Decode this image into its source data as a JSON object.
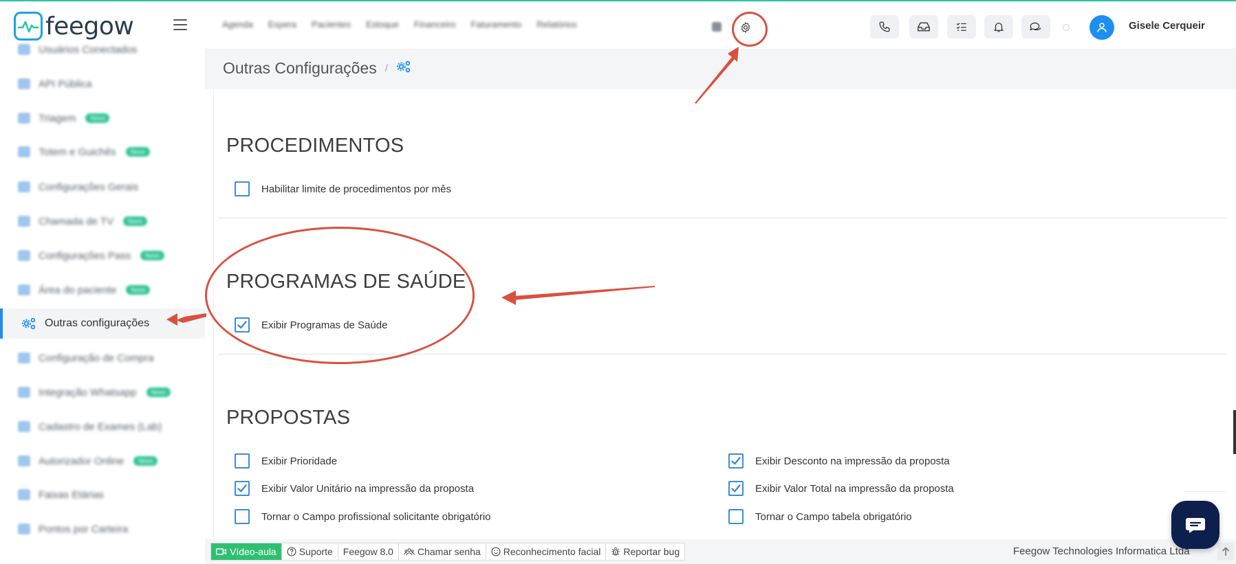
{
  "brand": {
    "logo_text": "feegow"
  },
  "header": {
    "nav_items": [
      "Agenda",
      "Espera",
      "Pacientes",
      "Estoque",
      "Financeiro",
      "Faturamento",
      "Relatórios"
    ],
    "username": "Gisele Cerqueir",
    "toolbar_icons": [
      "phone-icon",
      "inbox-icon",
      "task-list-icon",
      "bell-icon",
      "chat-icon"
    ]
  },
  "sidebar": {
    "items": [
      {
        "label": "Usuários Conectados",
        "badge": ""
      },
      {
        "label": "API Pública",
        "badge": ""
      },
      {
        "label": "Triagem",
        "badge": "Novo"
      },
      {
        "label": "Totem e Guichês",
        "badge": "Novo"
      },
      {
        "label": "Configurações Gerais",
        "badge": ""
      },
      {
        "label": "Chamada de TV",
        "badge": "Novo"
      },
      {
        "label": "Configurações Pass",
        "badge": "Novo"
      },
      {
        "label": "Área do paciente",
        "badge": "Novo"
      },
      {
        "label": "Outras configurações",
        "badge": ""
      },
      {
        "label": "Configuração de Compra",
        "badge": ""
      },
      {
        "label": "Integração Whatsapp",
        "badge": "Novo"
      },
      {
        "label": "Cadastro de Exames (Lab)",
        "badge": ""
      },
      {
        "label": "Autorizador Online",
        "badge": "Novo"
      },
      {
        "label": "Faixas Etárias",
        "badge": ""
      },
      {
        "label": "Pontos por Carteira",
        "badge": ""
      }
    ]
  },
  "page": {
    "title": "Outras Configurações",
    "separator": "/"
  },
  "sections": {
    "procedimentos": {
      "title": "PROCEDIMENTOS",
      "options": [
        {
          "label": "Habilitar limite de procedimentos por mês",
          "checked": false
        }
      ]
    },
    "programas": {
      "title": "PROGRAMAS DE SAÚDE",
      "options": [
        {
          "label": "Exibir Programas de Saúde",
          "checked": true
        }
      ]
    },
    "propostas": {
      "title": "PROPOSTAS",
      "options": [
        {
          "label": "Exibir Prioridade",
          "checked": false
        },
        {
          "label": "Exibir Desconto na impressão da proposta",
          "checked": true
        },
        {
          "label": "Exibir Valor Unitário na impressão da proposta",
          "checked": true
        },
        {
          "label": "Exibir Valor Total na impressão da proposta",
          "checked": true
        },
        {
          "label": "Tornar o Campo profissional solicitante obrigatório",
          "checked": false
        },
        {
          "label": "Tornar o Campo tabela obrigatório",
          "checked": false
        }
      ]
    }
  },
  "footer": {
    "video": "Vídeo-aula",
    "suporte": "Suporte",
    "version": "Feegow 8.0",
    "chamar": "Chamar senha",
    "facial": "Reconhecimento facial",
    "bug": "Reportar bug",
    "company": "Feegow Technologies Informatica Ltda"
  },
  "colors": {
    "accent": "#1e8ef0",
    "annotation": "#d9503f",
    "success": "#2fbf71",
    "chat": "#0c1f4d"
  }
}
